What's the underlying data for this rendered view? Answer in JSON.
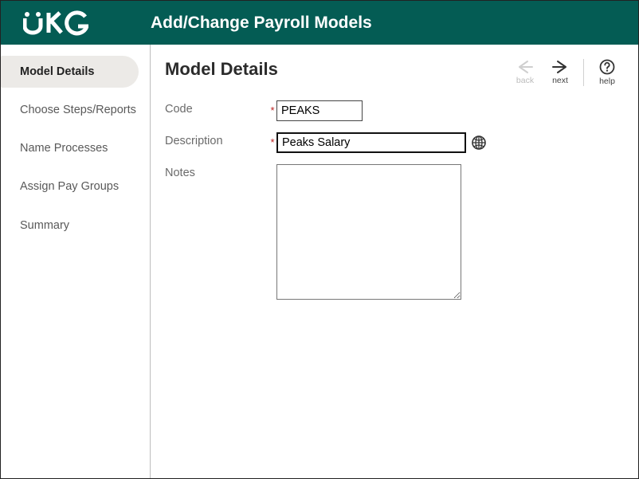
{
  "header": {
    "title": "Add/Change Payroll Models"
  },
  "sidebar": {
    "items": [
      {
        "label": "Model Details"
      },
      {
        "label": "Choose Steps/Reports"
      },
      {
        "label": "Name Processes"
      },
      {
        "label": "Assign Pay Groups"
      },
      {
        "label": "Summary"
      }
    ]
  },
  "main": {
    "title": "Model Details",
    "toolbar": {
      "back_label": "back",
      "next_label": "next",
      "help_label": "help"
    },
    "form": {
      "code_label": "Code",
      "code_value": "PEAKS",
      "description_label": "Description",
      "description_value": "Peaks Salary",
      "notes_label": "Notes",
      "notes_value": ""
    }
  }
}
